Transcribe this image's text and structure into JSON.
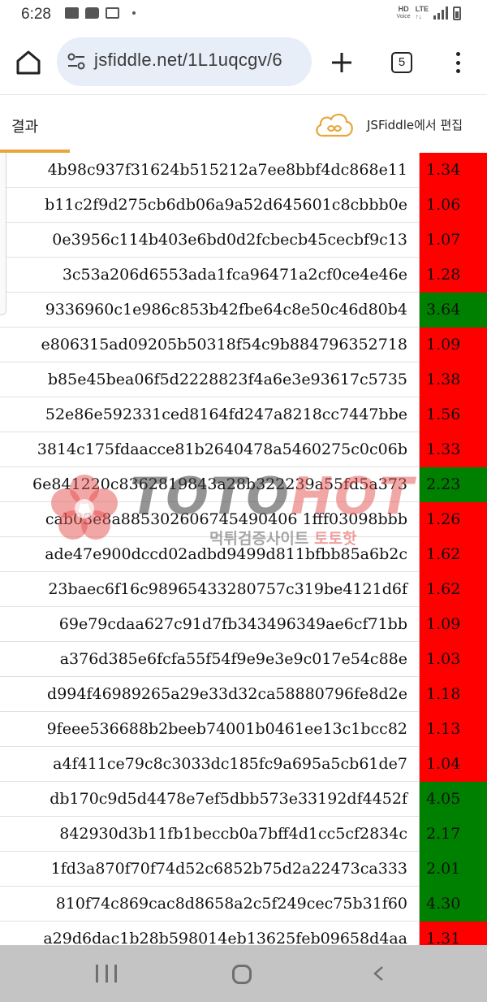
{
  "status_bar": {
    "time": "6:28",
    "hd_label": "HD",
    "voice_label": "Voice",
    "network_label": "LTE",
    "icons": [
      "gallery-icon",
      "message-icon",
      "news-icon",
      "dot-icon",
      "hd-voice-icon",
      "lte-icon",
      "signal-icon",
      "battery-icon"
    ]
  },
  "browser": {
    "url": "jsfiddle.net/1L1uqcgv/6",
    "tab_count": "5",
    "icons": [
      "home-icon",
      "site-settings-icon",
      "new-tab-icon",
      "tabs-icon",
      "more-menu-icon"
    ]
  },
  "fiddle_header": {
    "result_tab": "결과",
    "edit_link": "JSFiddle에서 편집",
    "accent_color": "#e7a73c"
  },
  "table": {
    "colors": {
      "low": "#ff0000",
      "high": "#008000"
    },
    "rows": [
      {
        "hash": "4b98c937f31624b515212a7ee8bbf4dc868e11",
        "odd": "1.34",
        "status": "low"
      },
      {
        "hash": "b11c2f9d275cb6db06a9a52d645601c8cbbb0e",
        "odd": "1.06",
        "status": "low"
      },
      {
        "hash": "0e3956c114b403e6bd0d2fcbecb45cecbf9c13",
        "odd": "1.07",
        "status": "low"
      },
      {
        "hash": "3c53a206d6553ada1fca96471a2cf0ce4e46e",
        "odd": "1.28",
        "status": "low"
      },
      {
        "hash": "9336960c1e986c853b42fbe64c8e50c46d80b4",
        "odd": "3.64",
        "status": "high"
      },
      {
        "hash": "e806315ad09205b50318f54c9b884796352718",
        "odd": "1.09",
        "status": "low"
      },
      {
        "hash": "b85e45bea06f5d2228823f4a6e3e93617c5735",
        "odd": "1.38",
        "status": "low"
      },
      {
        "hash": "52e86e592331ced8164fd247a8218cc7447bbe",
        "odd": "1.56",
        "status": "low"
      },
      {
        "hash": "3814c175fdaacce81b2640478a5460275c0c06b",
        "odd": "1.33",
        "status": "low"
      },
      {
        "hash": "6e841220c8362819843a28b322239a55fd5a373",
        "odd": "2.23",
        "status": "high"
      },
      {
        "hash": "cab03e8a885302606745490406 1fff03098bbb",
        "odd": "1.26",
        "status": "low"
      },
      {
        "hash": "ade47e900dccd02adbd9499d811bfbb85a6b2c",
        "odd": "1.62",
        "status": "low"
      },
      {
        "hash": "23baec6f16c98965433280757c319be4121d6f",
        "odd": "1.62",
        "status": "low"
      },
      {
        "hash": "69e79cdaa627c91d7fb343496349ae6cf71bb",
        "odd": "1.09",
        "status": "low"
      },
      {
        "hash": "a376d385e6fcfa55f54f9e9e3e9c017e54c88e",
        "odd": "1.03",
        "status": "low"
      },
      {
        "hash": "d994f46989265a29e33d32ca58880796fe8d2e",
        "odd": "1.18",
        "status": "low"
      },
      {
        "hash": "9feee536688b2beeb74001b0461ee13c1bcc82",
        "odd": "1.13",
        "status": "low"
      },
      {
        "hash": "a4f411ce79c8c3033dc185fc9a695a5cb61de7",
        "odd": "1.04",
        "status": "low"
      },
      {
        "hash": "db170c9d5d4478e7ef5dbb573e33192df4452f",
        "odd": "4.05",
        "status": "high"
      },
      {
        "hash": "842930d3b11fb1beccb0a7bff4d1cc5cf2834c",
        "odd": "2.17",
        "status": "high"
      },
      {
        "hash": "1fd3a870f70f74d52c6852b75d2a22473ca333",
        "odd": "2.01",
        "status": "high"
      },
      {
        "hash": "810f74c869cac8d8658a2c5f249cec75b31f60",
        "odd": "4.30",
        "status": "high"
      },
      {
        "hash": "a29d6dac1b28b598014eb13625feb09658d4aa",
        "odd": "1.31",
        "status": "low"
      }
    ]
  },
  "watermark": {
    "main_a": "TOTO",
    "main_b": "HOT",
    "sub_a": "먹튀검증사이트 ",
    "sub_b": "토토핫"
  },
  "nav_bar": {
    "icons": [
      "recent-apps-icon",
      "home-nav-icon",
      "back-icon"
    ]
  }
}
